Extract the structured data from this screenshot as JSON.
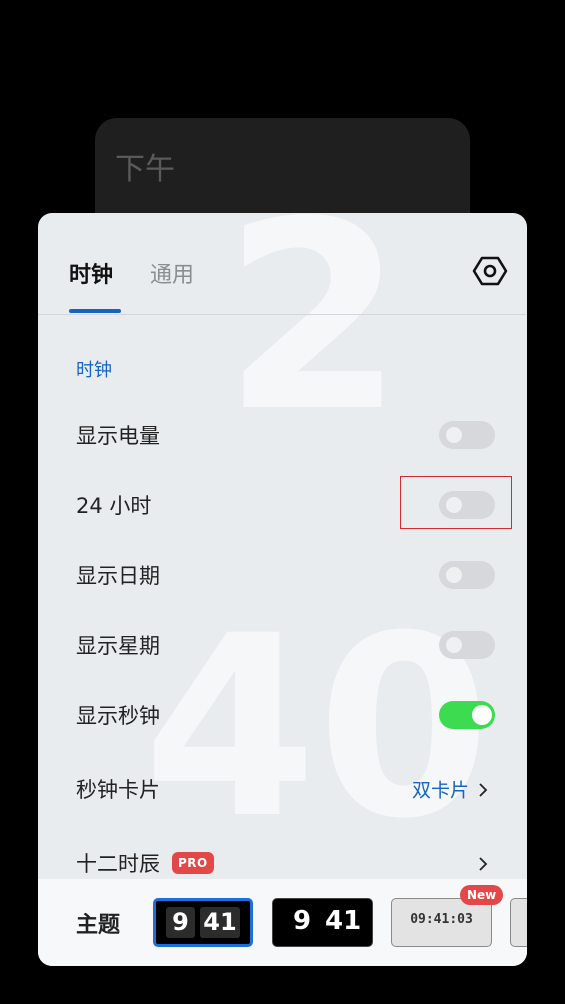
{
  "background_card": {
    "ampm": "下午",
    "hour_digit": "2",
    "minute_digits": "40"
  },
  "tabs": [
    {
      "label": "时钟",
      "active": true
    },
    {
      "label": "通用",
      "active": false
    }
  ],
  "settings_icon": "gear-hex-icon",
  "section": {
    "title": "时钟"
  },
  "rows": [
    {
      "label": "显示电量",
      "type": "toggle",
      "on": false
    },
    {
      "label": "24 小时",
      "type": "toggle",
      "on": false,
      "highlighted": true
    },
    {
      "label": "显示日期",
      "type": "toggle",
      "on": false
    },
    {
      "label": "显示星期",
      "type": "toggle",
      "on": false
    },
    {
      "label": "显示秒钟",
      "type": "toggle",
      "on": true
    },
    {
      "label": "秒钟卡片",
      "type": "link",
      "value": "双卡片"
    },
    {
      "label": "十二时辰",
      "type": "link",
      "badge": "PRO"
    }
  ],
  "theme": {
    "label": "主题",
    "items": [
      {
        "name": "flip-theme",
        "hour": "9",
        "minute": "41",
        "selected": true
      },
      {
        "name": "plain-theme",
        "hour": "9",
        "minute": "41"
      },
      {
        "name": "led-theme",
        "time": "09:41:03",
        "badge": "New"
      },
      {
        "name": "more-theme"
      }
    ]
  },
  "colors": {
    "accent": "#1565c0",
    "toggle_on": "#3ddc50",
    "badge": "#e34848"
  }
}
